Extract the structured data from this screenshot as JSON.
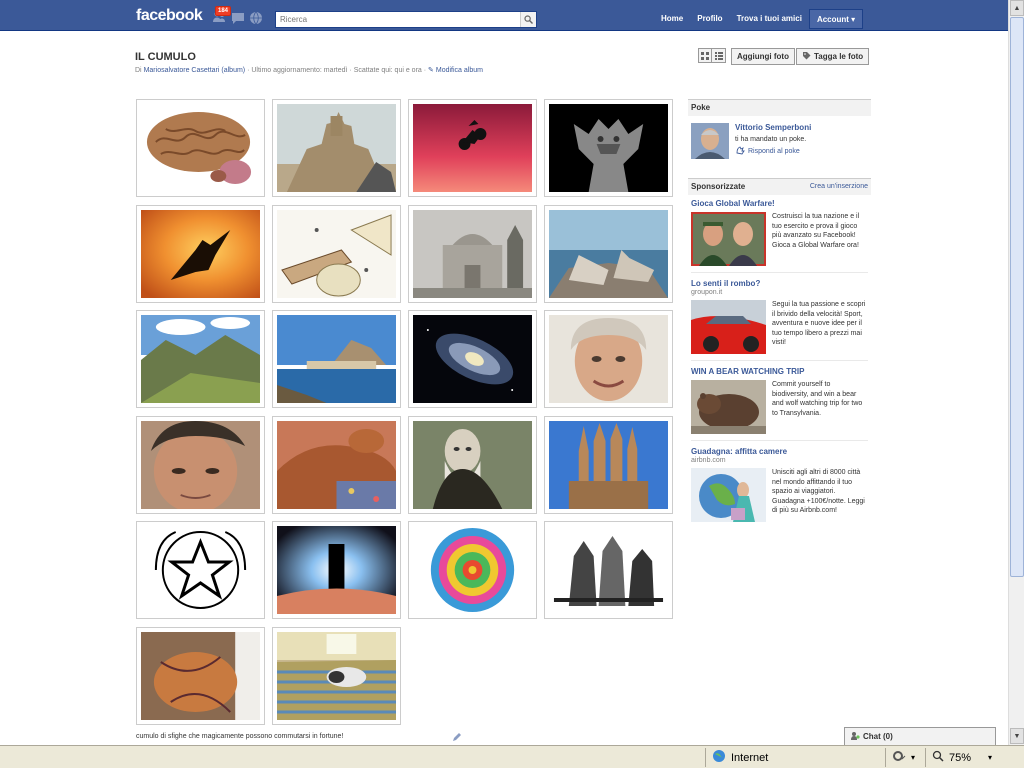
{
  "header": {
    "logo": "facebook",
    "notification_count": "184",
    "search_placeholder": "Ricerca",
    "nav": [
      "Home",
      "Profilo",
      "Trova i tuoi amici",
      "Account"
    ]
  },
  "album": {
    "title": "IL CUMULO",
    "by_prefix": "Di",
    "owner": "Mariosalvatore Casettari",
    "album_link": "(album)",
    "updated": "· Ultimo aggiornamento: martedì · Scattate qui: qui e ora ·",
    "edit_link": "Modifica album",
    "caption": "cumulo di sfighe che magicamente possono commutarsi in fortune!"
  },
  "toolbar": {
    "add_photos": "Aggiungi foto",
    "tag_photos": "Tagga le foto"
  },
  "photos": [
    {
      "name": "brain"
    },
    {
      "name": "sand-castle"
    },
    {
      "name": "motocross-sunset"
    },
    {
      "name": "gargoyle"
    },
    {
      "name": "eagle-sunset"
    },
    {
      "name": "wasp-drawing"
    },
    {
      "name": "foggy-church"
    },
    {
      "name": "wolves-sea"
    },
    {
      "name": "mountain-valley"
    },
    {
      "name": "cefalu-coast"
    },
    {
      "name": "galaxy"
    },
    {
      "name": "old-man-portrait"
    },
    {
      "name": "man-portrait"
    },
    {
      "name": "sleeping-dog"
    },
    {
      "name": "darwin-portrait"
    },
    {
      "name": "sagrada-familia"
    },
    {
      "name": "italian-emblem"
    },
    {
      "name": "monolith"
    },
    {
      "name": "mandala"
    },
    {
      "name": "horses-drawing"
    },
    {
      "name": "dog-tangled"
    },
    {
      "name": "dog-on-rug"
    }
  ],
  "sidebar": {
    "poke_header": "Poke",
    "poke_name": "Vittorio Semperboni",
    "poke_msg": "ti ha mandato un poke.",
    "poke_reply": "Rispondi al poke",
    "sponsored_header": "Sponsorizzate",
    "create_ad": "Crea un'inserzione",
    "ads": [
      {
        "title": "Gioca Global Warfare!",
        "domain": "",
        "text": "Costruisci la tua nazione e il tuo esercito e prova il gioco più avanzato su Facebook! Gioca a Global Warfare ora!"
      },
      {
        "title": "Lo senti il rombo?",
        "domain": "groupon.it",
        "text": "Segui la tua passione e scopri il brivido della velocità! Sport, avventura e nuove idee per il tuo tempo libero a prezzi mai visti!"
      },
      {
        "title": "WIN A BEAR WATCHING TRIP",
        "domain": "",
        "text": "Commit yourself to biodiversity, and win a bear and wolf watching trip for two to Transylvania."
      },
      {
        "title": "Guadagna: affitta camere",
        "domain": "airbnb.com",
        "text": "Unisciti agli altri di 8000 città nel mondo affittando il tuo spazio ai viaggiatori. Guadagna +100€/notte. Leggi di più su Airbnb.com!"
      }
    ]
  },
  "chat": {
    "label": "Chat (0)"
  },
  "statusbar": {
    "zone": "Internet",
    "zoom": "75%"
  },
  "colors": {
    "brand": "#3b5998",
    "link": "#3b5998",
    "badge": "#f03d25"
  }
}
